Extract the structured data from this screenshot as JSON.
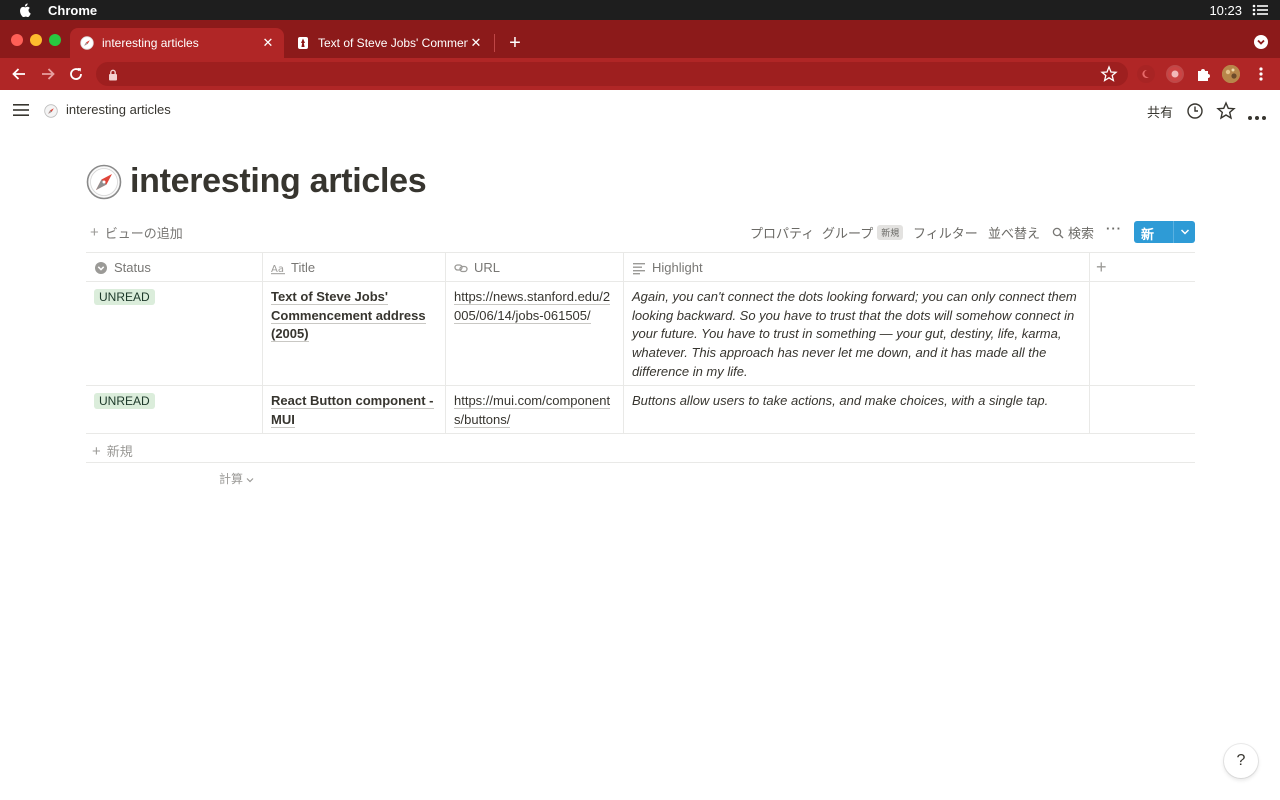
{
  "os": {
    "app_name": "Chrome",
    "clock": "10:23"
  },
  "browser": {
    "tabs": [
      {
        "label": "interesting articles",
        "active": true
      },
      {
        "label": "Text of Steve Jobs' Commence",
        "active": false
      }
    ],
    "url": "",
    "accent": "#8c1a1a"
  },
  "topbar": {
    "breadcrumb": "interesting articles",
    "share_label": "共有"
  },
  "page": {
    "title": "interesting articles",
    "icon": "compass-icon"
  },
  "viewbar": {
    "add_view": "ビューの追加",
    "properties": "プロパティ",
    "group": "グループ",
    "group_badge": "新規",
    "filter": "フィルター",
    "sort": "並べ替え",
    "search": "検索",
    "more": "···",
    "new_label": "新規",
    "new_color": "#2e9bd6"
  },
  "table": {
    "columns": [
      {
        "label": "Status",
        "icon": "select-icon"
      },
      {
        "label": "Title",
        "icon": "text-icon"
      },
      {
        "label": "URL",
        "icon": "link-icon"
      },
      {
        "label": "Highlight",
        "icon": "lines-icon"
      }
    ],
    "rows": [
      {
        "status": "UNREAD",
        "title": "Text of Steve Jobs' Commencement address (2005)",
        "url": "https://news.stanford.edu/2005/06/14/jobs-061505/",
        "highlight": "Again, you can't connect the dots looking forward; you can only connect them looking backward. So you have to trust that the dots will somehow connect in your future. You have to trust in something — your gut, destiny, life, karma, whatever. This approach has never let me down, and it has made all the difference in my life."
      },
      {
        "status": "UNREAD",
        "title": "React Button component - MUI",
        "url": "https://mui.com/components/buttons/",
        "highlight": "Buttons allow users to take actions, and make choices, with a single tap."
      }
    ],
    "new_row": "新規",
    "calculate": "計算"
  },
  "help": "?"
}
